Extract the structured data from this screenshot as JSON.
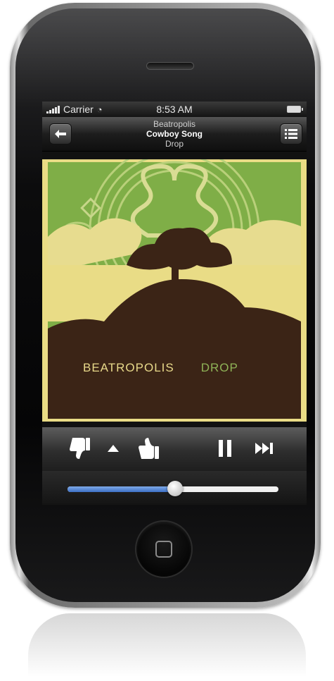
{
  "status_bar": {
    "carrier": "Carrier",
    "time": "8:53 AM"
  },
  "now_playing": {
    "artist": "Beatropolis",
    "song": "Cowboy Song",
    "album": "Drop"
  },
  "album_art": {
    "brand_text": "BEATROPOLIS",
    "album_text": "DROP"
  },
  "playback": {
    "progress": 0.51
  },
  "icons": {
    "back": "back-arrow-icon",
    "playlist": "list-icon",
    "thumbs_down": "thumbs-down-icon",
    "more": "up-arrow-icon",
    "thumbs_up": "thumbs-up-icon",
    "pause": "pause-icon",
    "skip": "skip-forward-icon",
    "home": "home-button-icon"
  },
  "colors": {
    "slider_fill": "#3d6fc5",
    "art_green": "#7fae47",
    "art_brown": "#3b2416"
  }
}
